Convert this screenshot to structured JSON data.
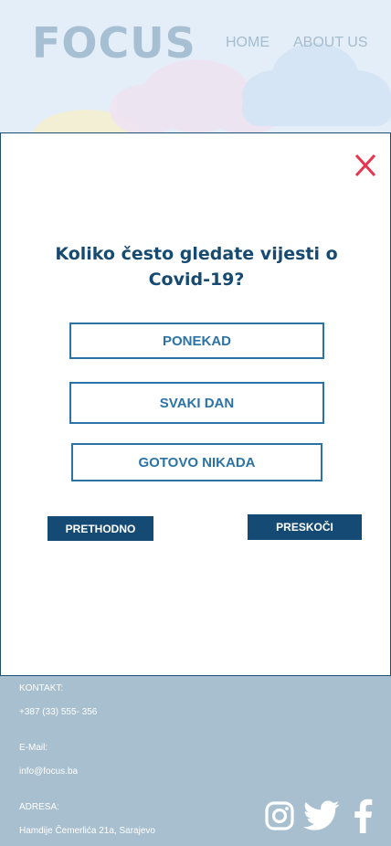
{
  "header": {
    "logo": "FOCUS",
    "nav": {
      "home": "HOME",
      "about": "ABOUT US"
    }
  },
  "modal": {
    "question": "Koliko često gledate vijesti o Covid-19?",
    "answers": [
      "PONEKAD",
      "SVAKI DAN",
      "GOTOVO NIKADA"
    ],
    "prev_label": "PRETHODNO",
    "skip_label": "PRESKOČI",
    "close_icon": "close-icon"
  },
  "footer": {
    "contact_label": "KONTAKT:",
    "phone": "+387 (33) 555- 356",
    "email_label": "E-Mail:",
    "email": "info@focus.ba",
    "address_label": "ADRESA:",
    "address": "Hamdije Čemerlića 21a, Sarajevo",
    "social": [
      "instagram-icon",
      "twitter-icon",
      "facebook-icon"
    ]
  },
  "colors": {
    "accent": "#144a73",
    "answer_border": "#2b73a6",
    "close": "#e8344e",
    "footer_bg": "#a7bfcf"
  }
}
